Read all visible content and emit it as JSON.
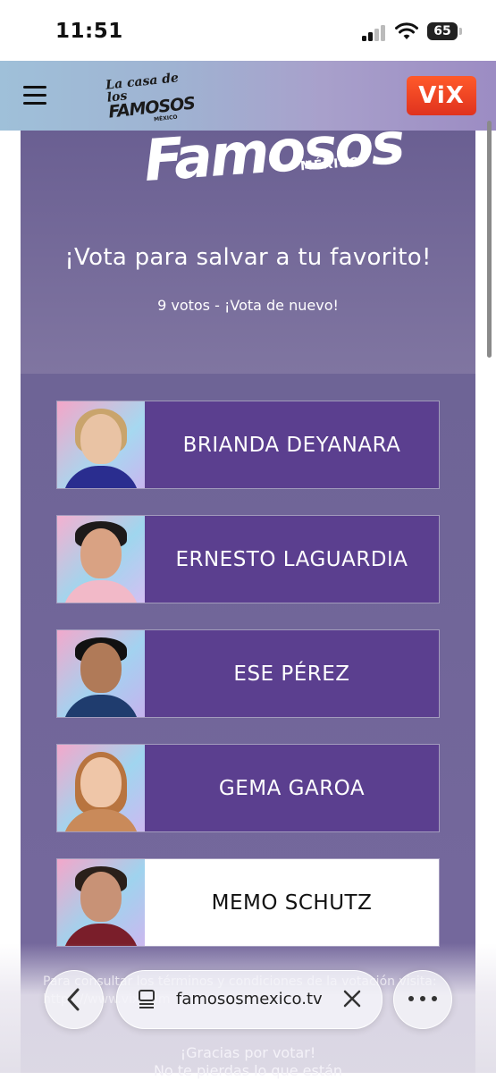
{
  "status_bar": {
    "time": "11:51",
    "battery": "65"
  },
  "header": {
    "brand_line1": "La casa de los",
    "brand_line2": "FAMOSOS",
    "brand_line3": "MÉXICO",
    "vix_label": "ViX"
  },
  "hero": {
    "logo_text": "Famosos",
    "logo_sub": "MÉXICO"
  },
  "vote": {
    "title": "¡Vota para salvar a tu favorito!",
    "count_text": "9 votos - ¡Vota de nuevo!"
  },
  "contestants": [
    {
      "name": "BRIANDA DEYANARA",
      "selected": false
    },
    {
      "name": "ERNESTO LAGUARDIA",
      "selected": false
    },
    {
      "name": "ESE PÉREZ",
      "selected": false
    },
    {
      "name": "GEMA GAROA",
      "selected": false
    },
    {
      "name": "MEMO SCHUTZ",
      "selected": true
    }
  ],
  "footer": {
    "text": "Para consultar los términos y condiciones de la votación visita: https://www.vix.com",
    "thanks_line1": "¡Gracias por votar!",
    "thanks_line2": "No te pierdas lo que están"
  },
  "browser": {
    "url": "famososmexico.tv"
  },
  "colors": {
    "name_box": "#5b3f8f",
    "vix": "#e8391f",
    "panel": "#756a9c"
  }
}
